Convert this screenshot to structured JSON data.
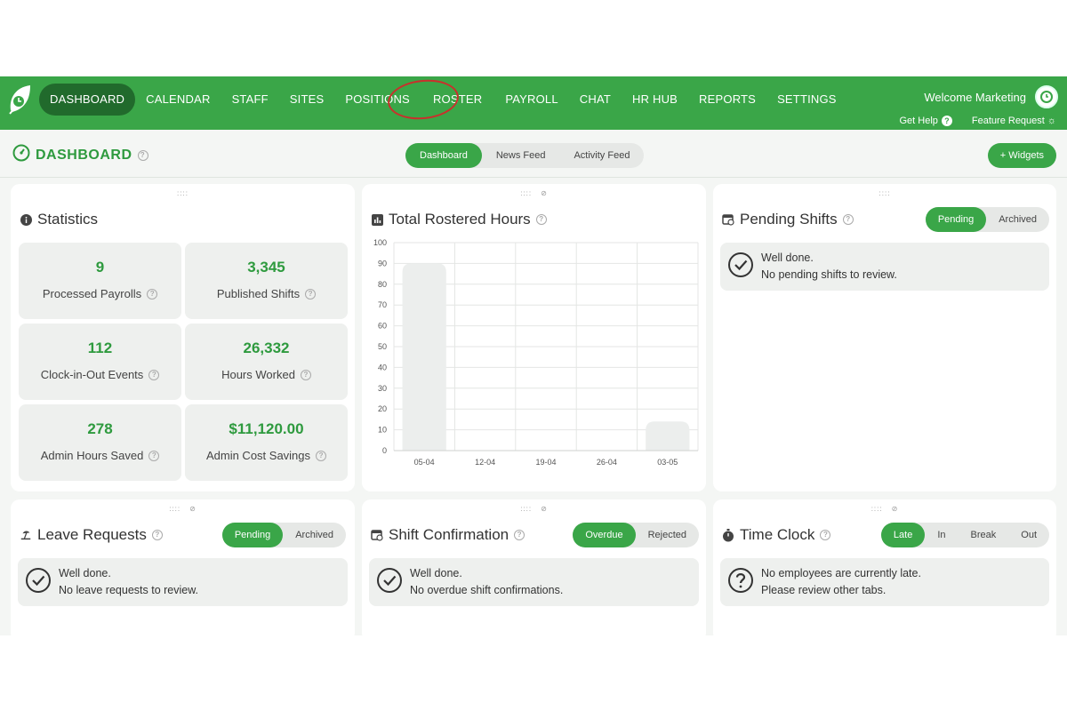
{
  "colors": {
    "brand_green": "#3aa648",
    "active_nav": "#216a2c",
    "annotation_red": "#c9302c"
  },
  "nav": {
    "items": [
      {
        "label": "DASHBOARD",
        "active": true
      },
      {
        "label": "CALENDAR"
      },
      {
        "label": "STAFF"
      },
      {
        "label": "SITES"
      },
      {
        "label": "POSITIONS"
      },
      {
        "label": "ROSTER",
        "annotated": true
      },
      {
        "label": "PAYROLL"
      },
      {
        "label": "CHAT"
      },
      {
        "label": "HR HUB"
      },
      {
        "label": "REPORTS"
      },
      {
        "label": "SETTINGS"
      }
    ],
    "welcome": "Welcome Marketing",
    "get_help": "Get Help",
    "feature_request": "Feature Request"
  },
  "header": {
    "title": "DASHBOARD",
    "views": [
      "Dashboard",
      "News Feed",
      "Activity Feed"
    ],
    "active_view": "Dashboard",
    "widgets_button": "+ Widgets"
  },
  "statistics": {
    "title": "Statistics",
    "items": [
      {
        "value": "9",
        "label": "Processed Payrolls"
      },
      {
        "value": "3,345",
        "label": "Published Shifts"
      },
      {
        "value": "112",
        "label": "Clock-in-Out Events"
      },
      {
        "value": "26,332",
        "label": "Hours Worked"
      },
      {
        "value": "278",
        "label": "Admin Hours Saved"
      },
      {
        "value": "$11,120.00",
        "label": "Admin Cost Savings"
      }
    ]
  },
  "rostered_hours": {
    "title": "Total Rostered Hours"
  },
  "chart_data": {
    "type": "bar",
    "title": "Total Rostered Hours",
    "categories": [
      "05-04",
      "12-04",
      "19-04",
      "26-04",
      "03-05"
    ],
    "values": [
      90,
      0,
      0,
      0,
      14
    ],
    "ylim": [
      0,
      100
    ],
    "yticks": [
      0,
      10,
      20,
      30,
      40,
      50,
      60,
      70,
      80,
      90,
      100
    ],
    "grid": true,
    "bar_color": "#eceeed"
  },
  "pending_shifts": {
    "title": "Pending Shifts",
    "tabs": [
      "Pending",
      "Archived"
    ],
    "message_line1": "Well done.",
    "message_line2": "No pending shifts to review."
  },
  "leave_requests": {
    "title": "Leave Requests",
    "tabs": [
      "Pending",
      "Archived"
    ],
    "message_line1": "Well done.",
    "message_line2": "No leave requests to review."
  },
  "shift_confirmation": {
    "title": "Shift Confirmation",
    "tabs": [
      "Overdue",
      "Rejected"
    ],
    "message_line1": "Well done.",
    "message_line2": "No overdue shift confirmations."
  },
  "time_clock": {
    "title": "Time Clock",
    "tabs": [
      "Late",
      "In",
      "Break",
      "Out"
    ],
    "message_line1": "No employees are currently late.",
    "message_line2": "Please review other tabs."
  }
}
